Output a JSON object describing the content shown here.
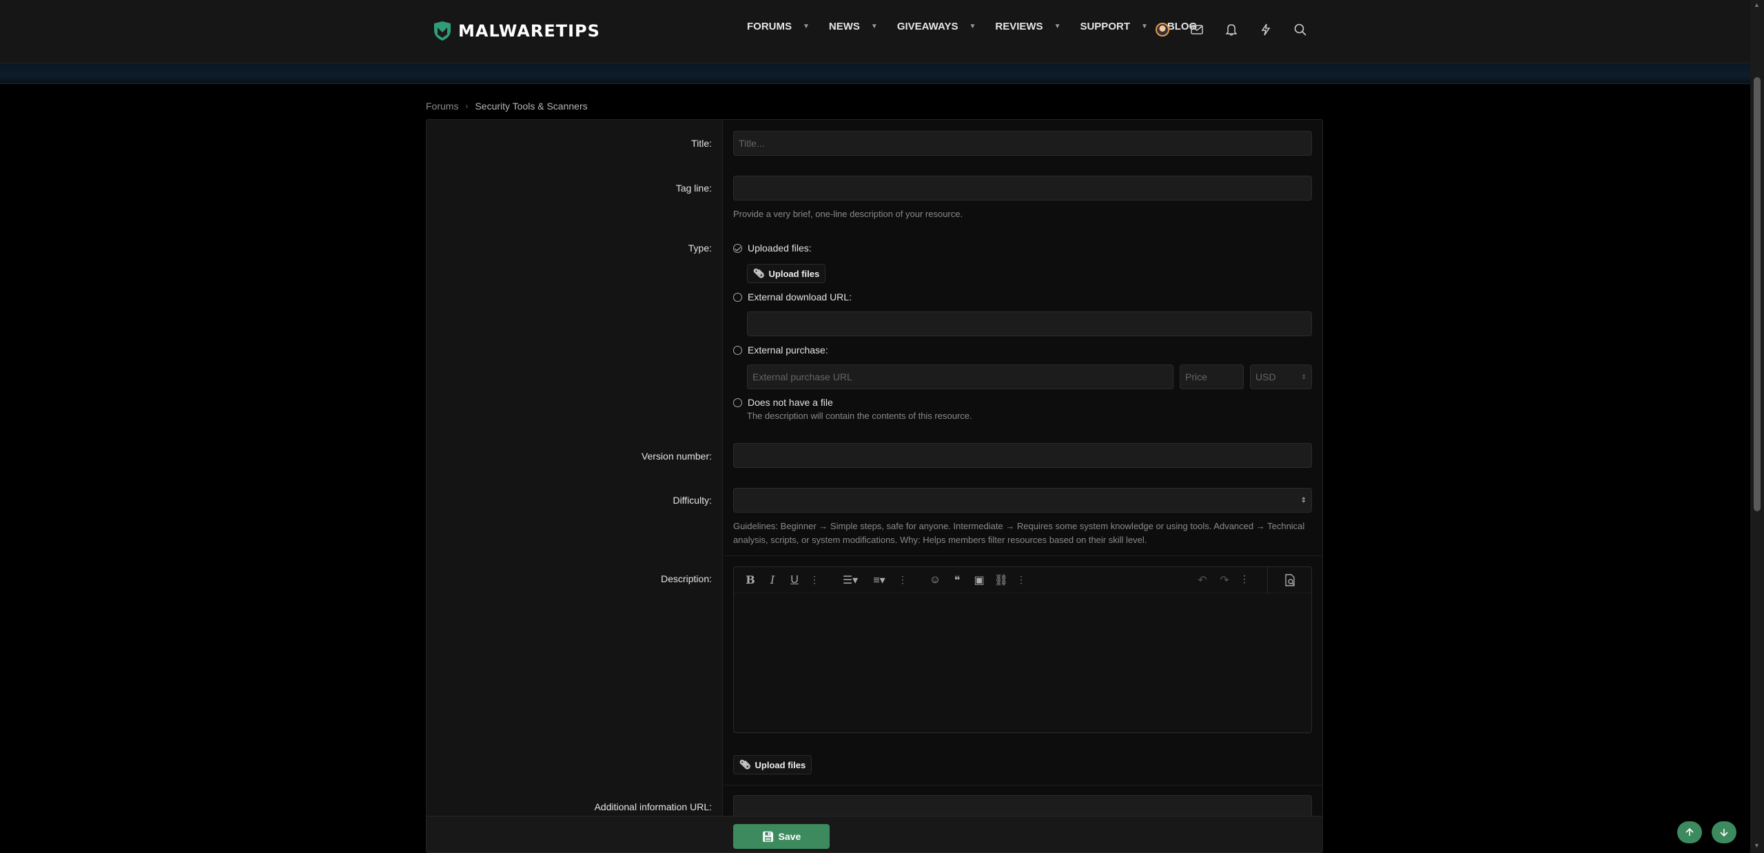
{
  "header": {
    "brand": "MALWARETIPS",
    "nav": [
      {
        "label": "FORUMS"
      },
      {
        "label": "NEWS"
      },
      {
        "label": "GIVEAWAYS"
      },
      {
        "label": "REVIEWS"
      },
      {
        "label": "SUPPORT"
      },
      {
        "label": "BLOG"
      }
    ]
  },
  "breadcrumb": {
    "root": "Forums",
    "current": "Security Tools & Scanners"
  },
  "form": {
    "title_label": "Title:",
    "title_placeholder": "Title...",
    "tagline_label": "Tag line:",
    "tagline_hint": "Provide a very brief, one-line description of your resource.",
    "type_label": "Type:",
    "type_uploaded": "Uploaded files:",
    "upload_files": "Upload files",
    "type_external_download": "External download URL:",
    "type_external_purchase": "External purchase:",
    "purchase_url_placeholder": "External purchase URL",
    "price_placeholder": "Price",
    "currency": "USD",
    "type_no_file": "Does not have a file",
    "type_no_file_hint": "The description will contain the contents of this resource.",
    "version_label": "Version number:",
    "difficulty_label": "Difficulty:",
    "difficulty_hint": "Guidelines: Beginner → Simple steps, safe for anyone. Intermediate → Requires some system knowledge or using tools. Advanced → Technical analysis, scripts, or system modifications. Why: Helps members filter resources based on their skill level.",
    "description_label": "Description:",
    "upload_files_2": "Upload files",
    "additional_url_label": "Additional information URL:",
    "save": "Save"
  },
  "colors": {
    "accent": "#3c8a5e",
    "background": "#000000",
    "panel": "#0d0d0d"
  }
}
